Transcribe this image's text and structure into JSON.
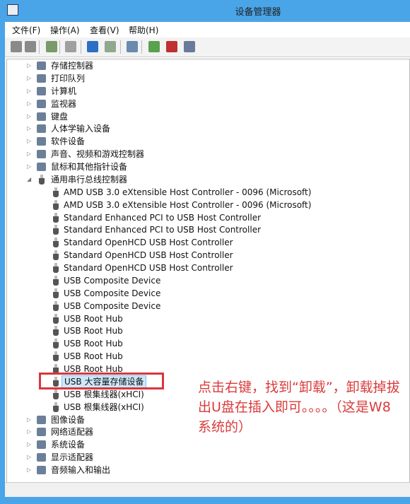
{
  "window": {
    "title": "设备管理器"
  },
  "menu": [
    "文件(F)",
    "操作(A)",
    "查看(V)",
    "帮助(H)"
  ],
  "toolbar": [
    "back",
    "forward",
    "show-hide-console-tree",
    "properties",
    "help",
    "action-pane",
    "scan-hardware",
    "update-driver",
    "uninstall",
    "disable"
  ],
  "tree": [
    {
      "label": "存储控制器",
      "level": 0,
      "icon": "storage-icon"
    },
    {
      "label": "打印队列",
      "level": 0,
      "icon": "printer-icon"
    },
    {
      "label": "计算机",
      "level": 0,
      "icon": "computer-icon"
    },
    {
      "label": "监视器",
      "level": 0,
      "icon": "monitor-icon"
    },
    {
      "label": "键盘",
      "level": 0,
      "icon": "keyboard-icon"
    },
    {
      "label": "人体学输入设备",
      "level": 0,
      "icon": "hid-icon"
    },
    {
      "label": "软件设备",
      "level": 0,
      "icon": "software-device-icon"
    },
    {
      "label": "声音、视频和游戏控制器",
      "level": 0,
      "icon": "sound-icon"
    },
    {
      "label": "鼠标和其他指针设备",
      "level": 0,
      "icon": "mouse-icon"
    },
    {
      "label": "通用串行总线控制器",
      "level": 0,
      "icon": "usb-icon",
      "expanded": true
    },
    {
      "label": "AMD USB 3.0 eXtensible Host Controller - 0096 (Microsoft)",
      "level": 1
    },
    {
      "label": "AMD USB 3.0 eXtensible Host Controller - 0096 (Microsoft)",
      "level": 1
    },
    {
      "label": "Standard Enhanced PCI to USB Host Controller",
      "level": 1
    },
    {
      "label": "Standard Enhanced PCI to USB Host Controller",
      "level": 1
    },
    {
      "label": "Standard OpenHCD USB Host Controller",
      "level": 1
    },
    {
      "label": "Standard OpenHCD USB Host Controller",
      "level": 1
    },
    {
      "label": "Standard OpenHCD USB Host Controller",
      "level": 1
    },
    {
      "label": "USB Composite Device",
      "level": 1
    },
    {
      "label": "USB Composite Device",
      "level": 1
    },
    {
      "label": "USB Composite Device",
      "level": 1
    },
    {
      "label": "USB Root Hub",
      "level": 1
    },
    {
      "label": "USB Root Hub",
      "level": 1
    },
    {
      "label": "USB Root Hub",
      "level": 1
    },
    {
      "label": "USB Root Hub",
      "level": 1
    },
    {
      "label": "USB Root Hub",
      "level": 1
    },
    {
      "label": "USB 大容量存储设备",
      "level": 1,
      "selected": true
    },
    {
      "label": "USB 根集线器(xHCI)",
      "level": 1
    },
    {
      "label": "USB 根集线器(xHCI)",
      "level": 1
    },
    {
      "label": "图像设备",
      "level": 0,
      "icon": "camera-icon"
    },
    {
      "label": "网络适配器",
      "level": 0,
      "icon": "network-icon"
    },
    {
      "label": "系统设备",
      "level": 0,
      "icon": "system-icon"
    },
    {
      "label": "显示适配器",
      "level": 0,
      "icon": "display-adapter-icon"
    },
    {
      "label": "音频输入和输出",
      "level": 0,
      "icon": "audio-icon"
    }
  ],
  "annotation": {
    "text": "点击右键，找到“卸载”，卸载掉拔出U盘在插入即可。。。。（这是W8系统的）",
    "color": "#d93b3b"
  }
}
